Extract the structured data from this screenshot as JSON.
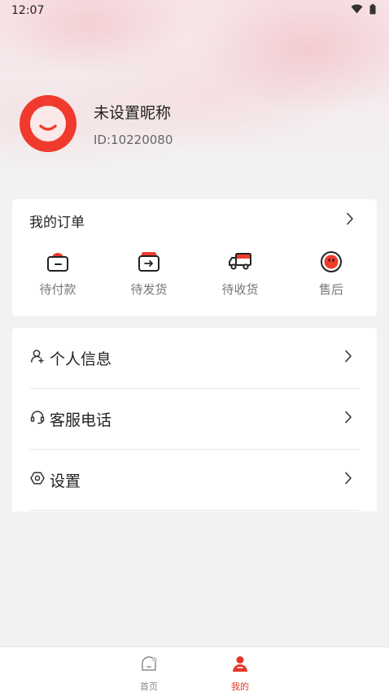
{
  "status_bar": {
    "time": "12:07",
    "icons": [
      "wifi-icon",
      "battery-icon"
    ]
  },
  "profile": {
    "nickname": "未设置昵称",
    "user_id": "ID:10220080"
  },
  "orders": {
    "title": "我的订单",
    "items": [
      {
        "label": "待付款",
        "icon": "wallet-icon"
      },
      {
        "label": "待发货",
        "icon": "shipping-box-icon"
      },
      {
        "label": "待收货",
        "icon": "delivery-truck-icon"
      },
      {
        "label": "售后",
        "icon": "after-sales-icon"
      }
    ]
  },
  "menu": [
    {
      "label": "个人信息",
      "icon": "user-icon"
    },
    {
      "label": "客服电话",
      "icon": "headset-icon"
    },
    {
      "label": "设置",
      "icon": "settings-icon"
    }
  ],
  "tabbar": [
    {
      "label": "首页",
      "icon": "home-icon",
      "active": false
    },
    {
      "label": "我的",
      "icon": "profile-icon",
      "active": true
    }
  ],
  "colors": {
    "accent": "#e8352b",
    "avatar": "#f03a2d",
    "background": "#f2f2f2"
  }
}
